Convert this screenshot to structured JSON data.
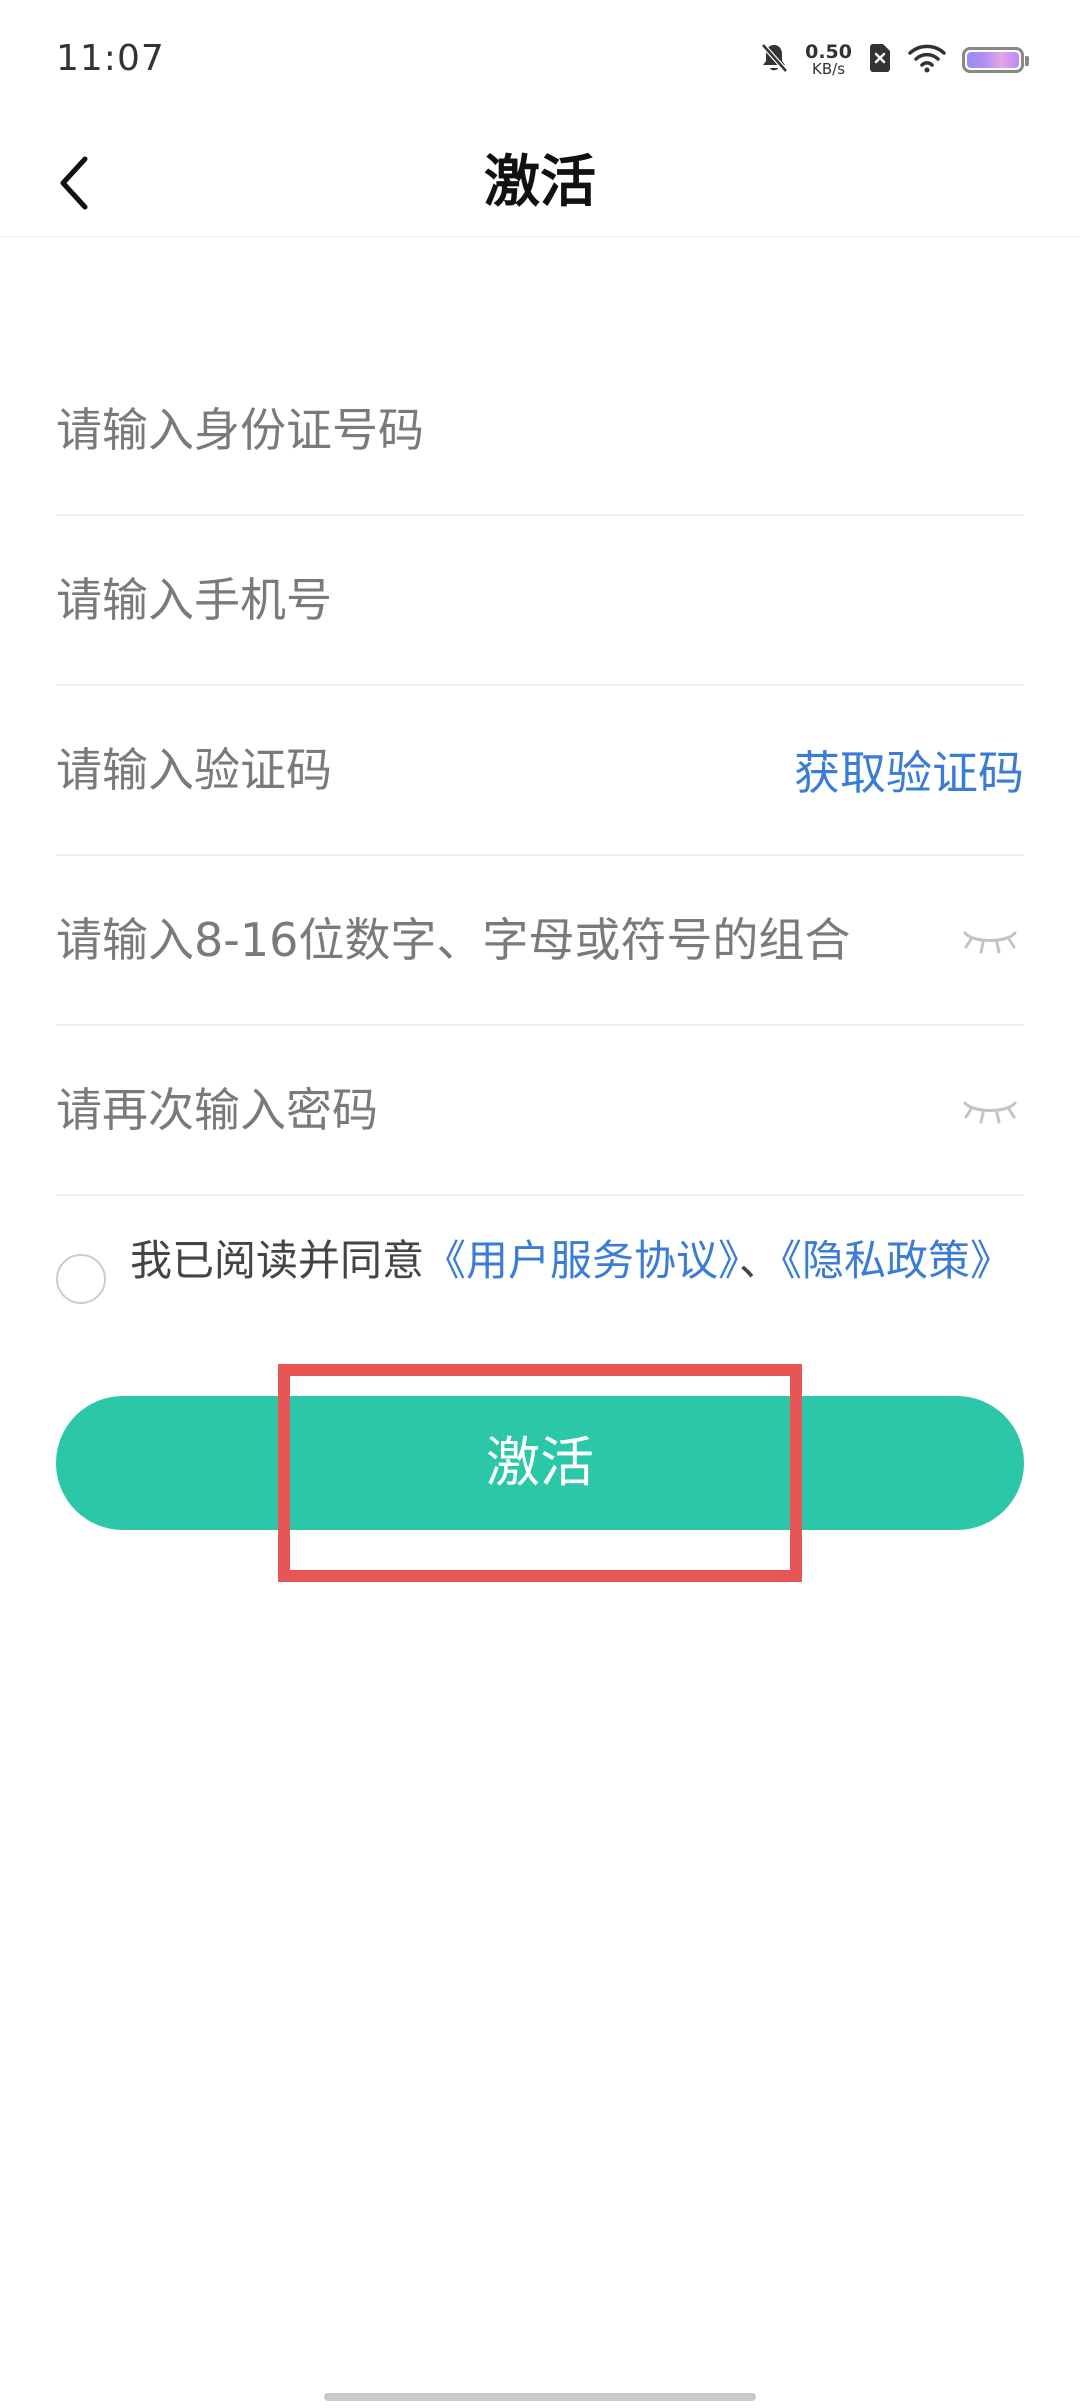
{
  "status_bar": {
    "time": "11:07",
    "net_speed_value": "0.50",
    "net_speed_unit": "KB/s",
    "icons": [
      "mute-bell-icon",
      "sim-x-icon",
      "wifi-icon",
      "battery-icon"
    ]
  },
  "nav": {
    "title": "激活",
    "back_icon": "chevron-left-icon"
  },
  "form": {
    "id_placeholder": "请输入身份证号码",
    "phone_placeholder": "请输入手机号",
    "code_placeholder": "请输入验证码",
    "get_code_label": "获取验证码",
    "password_placeholder": "请输入8-16位数字、字母或符号的组合",
    "confirm_placeholder": "请再次输入密码"
  },
  "agreement": {
    "prefix": "我已阅读并同意",
    "user_agreement": "《用户服务协议》",
    "separator": "、",
    "privacy_policy": "《隐私政策》"
  },
  "button": {
    "activate_label": "激活"
  },
  "colors": {
    "accent_green": "#2bc7a8",
    "link_blue": "#3a7dd6",
    "highlight_red": "#e55655"
  }
}
